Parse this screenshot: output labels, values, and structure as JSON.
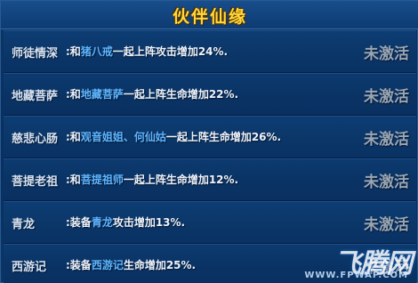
{
  "title": "伙伴仙缘",
  "rows": [
    {
      "name": "师徒情深",
      "desc": [
        ":和",
        "猪八戒",
        "一起上阵攻击增加24%."
      ],
      "status": "未激活"
    },
    {
      "name": "地藏菩萨",
      "desc": [
        ":和",
        "地藏菩萨",
        "一起上阵生命增加22%."
      ],
      "status": "未激活"
    },
    {
      "name": "慈悲心肠",
      "desc": [
        ":和",
        "观音姐姐、何仙姑",
        "一起上阵生命增加26%."
      ],
      "status": "未激活"
    },
    {
      "name": "菩提老祖",
      "desc": [
        ":和",
        "菩提祖师",
        "一起上阵生命增加12%."
      ],
      "status": "未激活"
    },
    {
      "name": "青龙",
      "desc": [
        ":装备",
        "青龙",
        "攻击增加13%."
      ],
      "status": "未激活"
    },
    {
      "name": "西游记",
      "desc": [
        ":装备",
        "西游记",
        "生命增加25%."
      ],
      "status": "未激活"
    }
  ],
  "watermark": {
    "text": "飞腾网",
    "url": "WWW.FPWAP.COM"
  },
  "colors": {
    "title": "#ffd83a",
    "highlight": "#5fb6ff",
    "status": "#9aa6b4",
    "background": "#0b3667"
  }
}
